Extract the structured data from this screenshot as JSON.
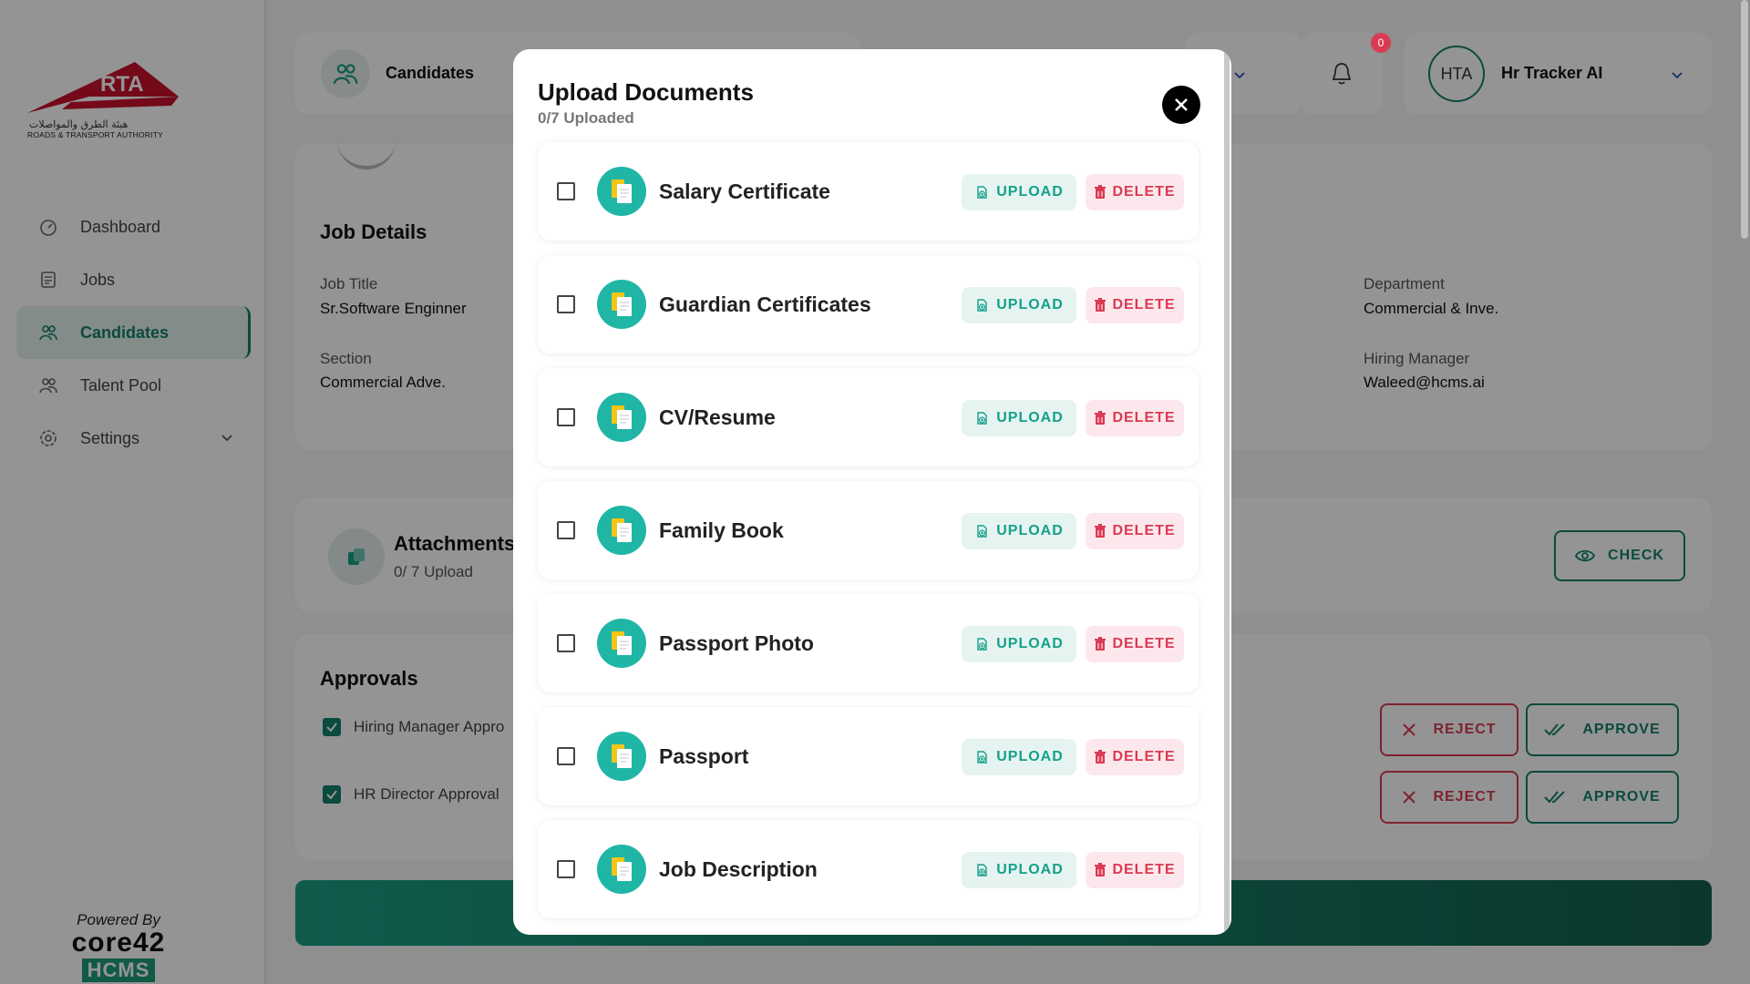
{
  "logo": {
    "brand": "RTA",
    "arabic": "هيئة الطرق والمواصلات",
    "english": "ROADS & TRANSPORT AUTHORITY"
  },
  "sidebar": {
    "items": [
      {
        "label": "Dashboard",
        "icon": "dashboard-icon"
      },
      {
        "label": "Jobs",
        "icon": "jobs-icon"
      },
      {
        "label": "Candidates",
        "icon": "candidates-icon",
        "active": true
      },
      {
        "label": "Talent Pool",
        "icon": "talent-pool-icon"
      },
      {
        "label": "Settings",
        "icon": "gear-icon"
      }
    ],
    "powered_by": "Powered By",
    "core_brand": "core42",
    "hcms_brand": "HCMS"
  },
  "header": {
    "page_title": "Candidates",
    "notification_count": "0",
    "avatar_initials": "HTA",
    "user_name": "Hr Tracker AI"
  },
  "job_details": {
    "title": "Job Details",
    "fields": {
      "job_title_label": "Job Title",
      "job_title_value": "Sr.Software Enginner",
      "section_label": "Section",
      "section_value": "Commercial Adve.",
      "department_label": "Department",
      "department_value": "Commercial & Inve.",
      "hiring_manager_label": "Hiring Manager",
      "hiring_manager_value": "Waleed@hcms.ai"
    }
  },
  "attachments": {
    "title": "Attachments",
    "subtitle": "0/ 7 Upload",
    "check_label": "CHECK"
  },
  "approvals": {
    "title": "Approvals",
    "rows": [
      {
        "label": "Hiring Manager Appro",
        "checked": true,
        "reject": "REJECT",
        "approve": "APPROVE"
      },
      {
        "label": "HR Director Approval",
        "checked": true,
        "reject": "REJECT",
        "approve": "APPROVE"
      }
    ]
  },
  "modal": {
    "title": "Upload Documents",
    "subtitle": "0/7 Uploaded",
    "upload_label": "UPLOAD",
    "delete_label": "DELETE",
    "documents": [
      {
        "name": "Salary Certificate"
      },
      {
        "name": "Guardian Certificates"
      },
      {
        "name": "CV/Resume"
      },
      {
        "name": "Family Book"
      },
      {
        "name": "Passport Photo"
      },
      {
        "name": "Passport"
      },
      {
        "name": "Job Description"
      }
    ]
  },
  "colors": {
    "accent": "#14806c",
    "danger": "#d93b53",
    "upload_bg": "#e6f4f1",
    "delete_bg": "#fce8ec",
    "brand_red": "#c8102e"
  }
}
